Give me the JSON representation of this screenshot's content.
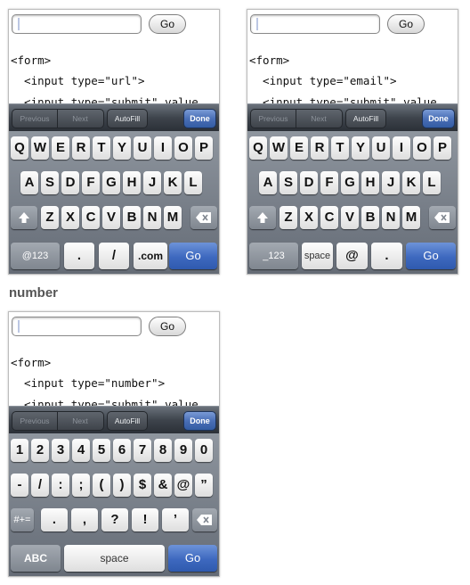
{
  "go_label": "Go",
  "toolbar": {
    "previous": "Previous",
    "next": "Next",
    "autofill": "AutoFill",
    "done": "Done"
  },
  "code": {
    "form": "<form>",
    "submit_line": "  <input type=\"submit\" value"
  },
  "url_phone": {
    "input_line": "  <input type=\"url\">",
    "rows": [
      [
        "Q",
        "W",
        "E",
        "R",
        "T",
        "Y",
        "U",
        "I",
        "O",
        "P"
      ],
      [
        "A",
        "S",
        "D",
        "F",
        "G",
        "H",
        "J",
        "K",
        "L"
      ],
      [
        "Z",
        "X",
        "C",
        "V",
        "B",
        "N",
        "M"
      ]
    ],
    "bottom": {
      "mode": "@123",
      "dot": ".",
      "slash": "/",
      "com": ".com",
      "go": "Go"
    }
  },
  "email_phone": {
    "input_line": "  <input type=\"email\">",
    "rows": [
      [
        "Q",
        "W",
        "E",
        "R",
        "T",
        "Y",
        "U",
        "I",
        "O",
        "P"
      ],
      [
        "A",
        "S",
        "D",
        "F",
        "G",
        "H",
        "J",
        "K",
        "L"
      ],
      [
        "Z",
        "X",
        "C",
        "V",
        "B",
        "N",
        "M"
      ]
    ],
    "bottom": {
      "mode": "_123",
      "space": "space",
      "at": "@",
      "dot": ".",
      "go": "Go"
    }
  },
  "caption": "number",
  "number_phone": {
    "input_line": "  <input type=\"number\">",
    "rows": [
      [
        "1",
        "2",
        "3",
        "4",
        "5",
        "6",
        "7",
        "8",
        "9",
        "0"
      ],
      [
        "-",
        "/",
        ":",
        ";",
        "(",
        ")",
        "$",
        "&",
        "@",
        "”"
      ]
    ],
    "row3": {
      "mode": "#+=",
      "keys": [
        ".",
        ",",
        "?",
        "!",
        "’"
      ]
    },
    "bottom": {
      "abc": "ABC",
      "space": "space",
      "go": "Go"
    }
  }
}
